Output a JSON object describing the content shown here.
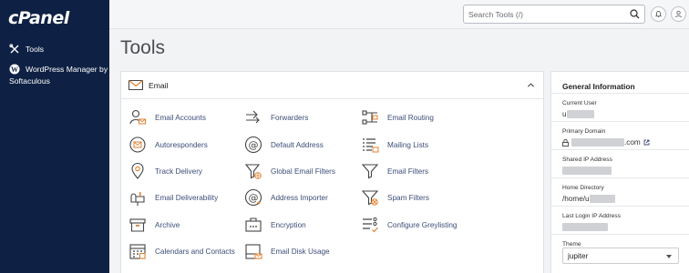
{
  "brand": {
    "logo": "cPanel"
  },
  "sidebar": {
    "items": [
      {
        "label": "Tools",
        "icon": "tools-icon"
      },
      {
        "label": "WordPress Manager by Softaculous",
        "icon": "wordpress-icon"
      }
    ]
  },
  "topbar": {
    "search_placeholder": "Search Tools (/)",
    "notifications_icon": "bell-icon",
    "user_icon": "user-icon"
  },
  "page": {
    "title": "Tools"
  },
  "email_panel": {
    "title": "Email",
    "tools": [
      {
        "label": "Email Accounts",
        "icon": "email-accounts-icon"
      },
      {
        "label": "Forwarders",
        "icon": "forwarders-icon"
      },
      {
        "label": "Email Routing",
        "icon": "email-routing-icon"
      },
      {
        "label": "Autoresponders",
        "icon": "autoresponders-icon"
      },
      {
        "label": "Default Address",
        "icon": "default-address-icon"
      },
      {
        "label": "Mailing Lists",
        "icon": "mailing-lists-icon"
      },
      {
        "label": "Track Delivery",
        "icon": "track-delivery-icon"
      },
      {
        "label": "Global Email Filters",
        "icon": "global-filters-icon"
      },
      {
        "label": "Email Filters",
        "icon": "email-filters-icon"
      },
      {
        "label": "Email Deliverability",
        "icon": "deliverability-icon"
      },
      {
        "label": "Address Importer",
        "icon": "address-importer-icon"
      },
      {
        "label": "Spam Filters",
        "icon": "spam-filters-icon"
      },
      {
        "label": "Archive",
        "icon": "archive-icon"
      },
      {
        "label": "Encryption",
        "icon": "encryption-icon"
      },
      {
        "label": "Configure Greylisting",
        "icon": "greylisting-icon"
      },
      {
        "label": "Calendars and Contacts",
        "icon": "calendars-icon"
      },
      {
        "label": "Email Disk Usage",
        "icon": "disk-usage-icon"
      }
    ]
  },
  "general_info": {
    "title": "General Information",
    "current_user_label": "Current User",
    "current_user_value": "u",
    "primary_domain_label": "Primary Domain",
    "primary_domain_suffix": ".com",
    "shared_ip_label": "Shared IP Address",
    "home_dir_label": "Home Directory",
    "home_dir_value": "/home/u",
    "last_login_label": "Last Login IP Address",
    "theme_label": "Theme",
    "theme_value": "jupiter"
  },
  "colors": {
    "sidebar": "#0e2144",
    "accent": "#e2812f",
    "link": "#3c4d78"
  }
}
